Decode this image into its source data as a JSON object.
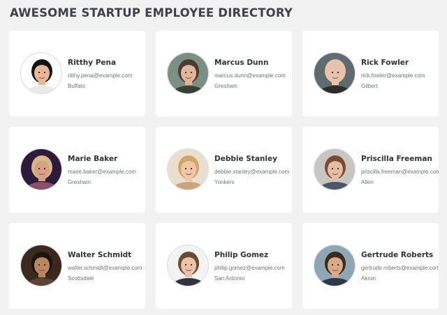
{
  "header": {
    "title": "AWESOME STARTUP EMPLOYEE DIRECTORY"
  },
  "employees": [
    {
      "name": "Ritthy Pena",
      "email": "ritthy.pena@example.com",
      "city": "Buffalo",
      "avatar": {
        "bg": "#ffffff",
        "skin": "#e8b896",
        "hair": "#141414",
        "shirt": "#e9e9e9"
      }
    },
    {
      "name": "Marcus Dunn",
      "email": "marcus.dunn@example.com",
      "city": "Gresham",
      "avatar": {
        "bg": "#7b8f82",
        "skin": "#e2b49b",
        "hair": "#4a3a30",
        "shirt": "#3a3f3c"
      }
    },
    {
      "name": "Rick Fowler",
      "email": "rick.fowler@example.com",
      "city": "Gilbert",
      "avatar": {
        "bg": "#5e6b70",
        "skin": "#e7c2ad",
        "hair": "#e7c2ad",
        "shirt": "#2e2b28"
      }
    },
    {
      "name": "Marie Baker",
      "email": "marie.baker@example.com",
      "city": "Gresham",
      "avatar": {
        "bg": "#2e1a3a",
        "skin": "#d6a089",
        "hair": "#d6b985",
        "shirt": "#8a4f6a"
      }
    },
    {
      "name": "Debbie Stanley",
      "email": "debbie.stanley@example.com",
      "city": "Yonkers",
      "avatar": {
        "bg": "#e9dfcf",
        "skin": "#f1c7a9",
        "hair": "#d3a566",
        "shirt": "#c9a57d"
      }
    },
    {
      "name": "Priscilla Freeman",
      "email": "priscilla.freeman@example.com",
      "city": "Allen",
      "avatar": {
        "bg": "#c9c5c3",
        "skin": "#e4bda6",
        "hair": "#7a4a32",
        "shirt": "#4a5868"
      }
    },
    {
      "name": "Walter Schmidt",
      "email": "walter.schmidt@example.com",
      "city": "Scottsdale",
      "avatar": {
        "bg": "#3a2a1e",
        "skin": "#b98661",
        "hair": "#1c1410",
        "shirt": "#5a4534"
      }
    },
    {
      "name": "Philip Gomez",
      "email": "philip.gomez@example.com",
      "city": "San Antonio",
      "avatar": {
        "bg": "#f3f3f3",
        "skin": "#ecc3a6",
        "hair": "#6b4a32",
        "shirt": "#2d3640"
      }
    },
    {
      "name": "Gertrude Roberts",
      "email": "gertrude.roberts@example.com",
      "city": "Akron",
      "avatar": {
        "bg": "#8fa7b3",
        "skin": "#d9a98a",
        "hair": "#3a2a20",
        "shirt": "#2c3a48"
      }
    }
  ]
}
